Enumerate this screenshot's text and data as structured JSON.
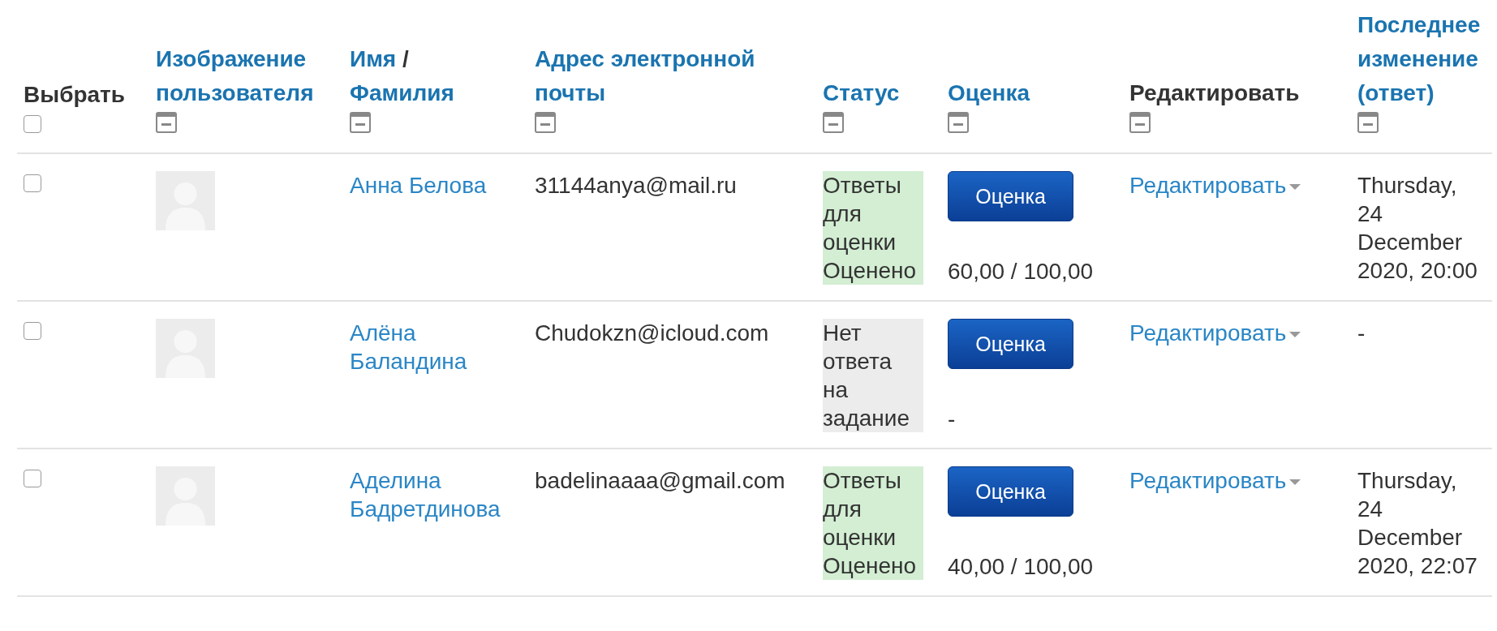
{
  "table": {
    "columns": [
      {
        "kind": "select",
        "label": "Выбрать",
        "checked": false
      },
      {
        "kind": "link",
        "label": "Изображение пользователя"
      },
      {
        "kind": "name",
        "links": [
          "Имя",
          "Фамилия"
        ],
        "separator": "/"
      },
      {
        "kind": "link",
        "label": "Адрес электронной почты"
      },
      {
        "kind": "link",
        "label": "Статус"
      },
      {
        "kind": "link",
        "label": "Оценка"
      },
      {
        "kind": "plain",
        "label": "Редактировать"
      },
      {
        "kind": "link",
        "label": "Последнее изменение (ответ)"
      }
    ],
    "rows": [
      {
        "checked": false,
        "name": "Анна Белова",
        "email": "31144anya@mail.ru",
        "status": [
          {
            "text": "Ответы для оценки",
            "kind": "submitted"
          },
          {
            "text": "Оценено",
            "kind": "graded"
          }
        ],
        "grade_button": "Оценка",
        "grade": "60,00 / 100,00",
        "edit": "Редактировать",
        "last_modified": "Thursday, 24 December 2020, 20:00"
      },
      {
        "checked": false,
        "name": "Алёна Баландина",
        "email": "Chudokzn@icloud.com",
        "status": [
          {
            "text": "Нет ответа на задание",
            "kind": "none"
          }
        ],
        "grade_button": "Оценка",
        "grade": "-",
        "edit": "Редактировать",
        "last_modified": "-"
      },
      {
        "checked": false,
        "name": "Аделина Бадретдинова",
        "email": "badelinaaaa@gmail.com",
        "status": [
          {
            "text": "Ответы для оценки",
            "kind": "submitted"
          },
          {
            "text": "Оценено",
            "kind": "graded"
          }
        ],
        "grade_button": "Оценка",
        "grade": "40,00 / 100,00",
        "edit": "Редактировать",
        "last_modified": "Thursday, 24 December 2020, 22:07"
      }
    ]
  }
}
